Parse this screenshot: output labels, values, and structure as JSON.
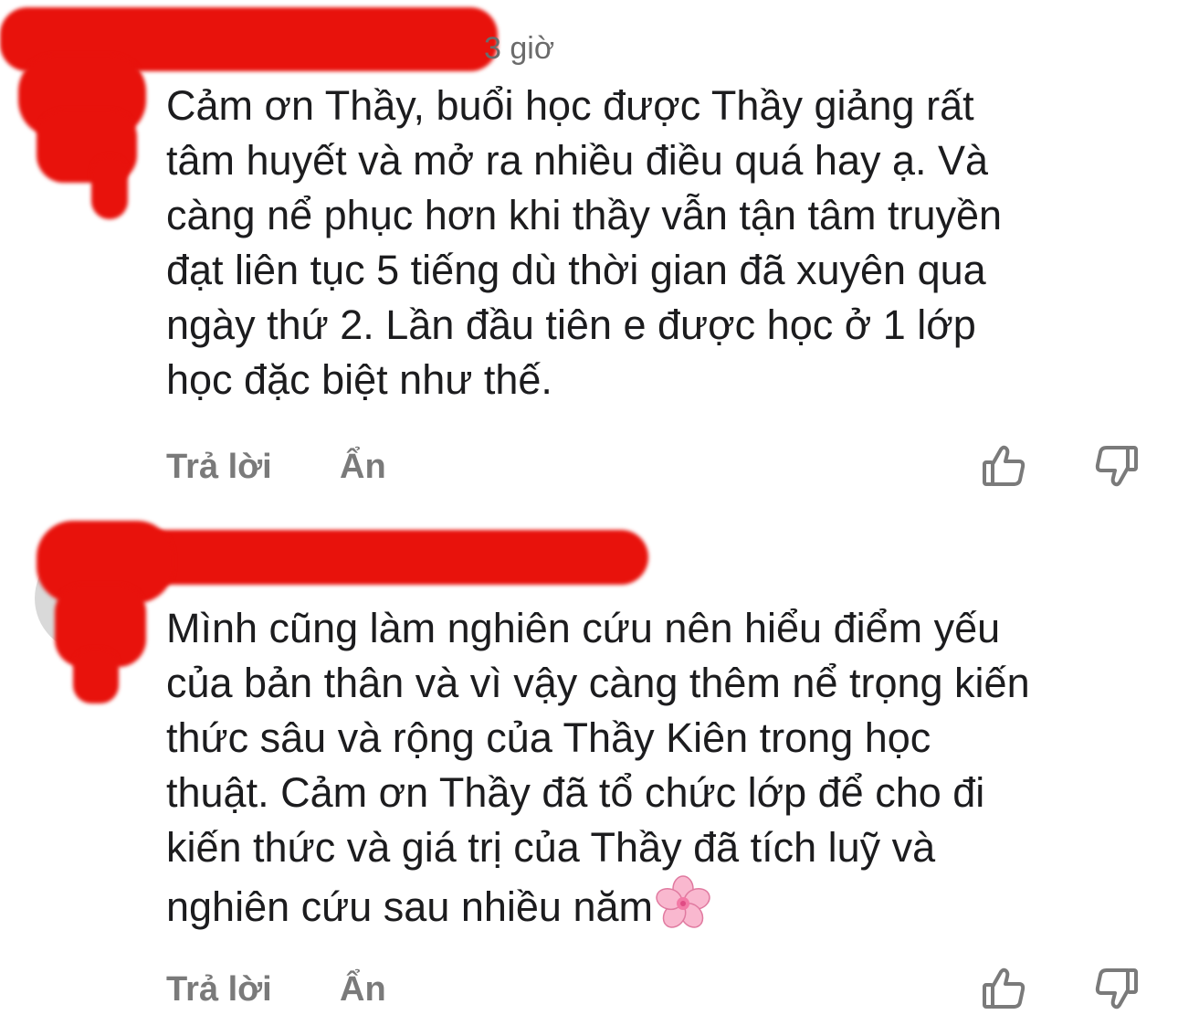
{
  "comments": [
    {
      "time": "3 giờ",
      "lines": [
        "Cảm ơn Thầy, buổi học được Thầy giảng rất",
        "tâm huyết và mở ra nhiều điều quá hay ạ. Và",
        "càng nể phục hơn khi thầy vẫn tận tâm truyền",
        "đạt liên tục 5 tiếng dù thời gian đã xuyên qua",
        "ngày thứ 2. Lần đầu tiên e được học ở 1 lớp",
        "học đặc biệt như thế."
      ],
      "reply_label": "Trả lời",
      "hide_label": "Ẩn"
    },
    {
      "time": "",
      "lines": [
        "Mình cũng làm nghiên cứu nên hiểu điểm yếu",
        "của bản thân và vì vậy càng thêm nể trọng kiến",
        "thức sâu và rộng của Thầy Kiên trong học",
        "thuật. Cảm ơn Thầy đã tổ chức lớp để cho đi",
        "kiến thức và giá trị của Thầy đã tích luỹ và",
        "nghiên cứu sau nhiều năm"
      ],
      "trailing_emoji": "cherry-blossom",
      "reply_label": "Trả lời",
      "hide_label": "Ẩn"
    }
  ],
  "icons": {
    "like": "thumbs-up-icon",
    "dislike": "thumbs-down-icon"
  },
  "colors": {
    "text": "#1c1c1e",
    "muted": "#7a7a7a",
    "redaction": "#e8120c"
  }
}
